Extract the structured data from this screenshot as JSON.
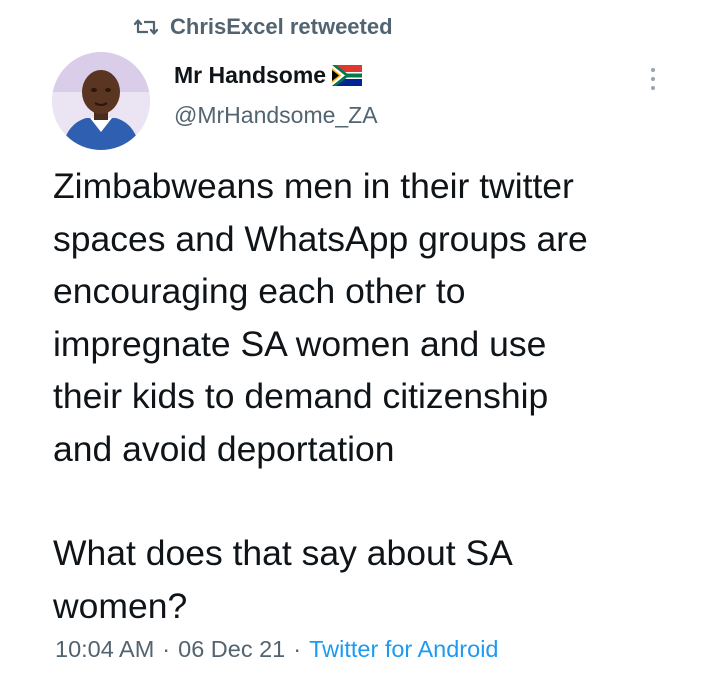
{
  "retweet": {
    "icon": "retweet-icon",
    "text": "ChrisExcel retweeted"
  },
  "author": {
    "name": "Mr Handsome",
    "flag_icon": "south-africa-flag-icon",
    "handle": "@MrHandsome_ZA"
  },
  "tweet": {
    "paragraph_1": "Zimbabweans men in their twitter\nspaces and WhatsApp groups are\nencouraging each other to\nimpregnate SA women and use\ntheir kids to demand citizenship\nand avoid deportation",
    "paragraph_2": "What does that say about SA\nwomen?"
  },
  "meta": {
    "time": "10:04 AM",
    "separator": "·",
    "date": "06 Dec 21",
    "source": "Twitter for Android"
  },
  "colors": {
    "text": "#0f1419",
    "secondary": "#536471",
    "link": "#1d9bf0"
  }
}
